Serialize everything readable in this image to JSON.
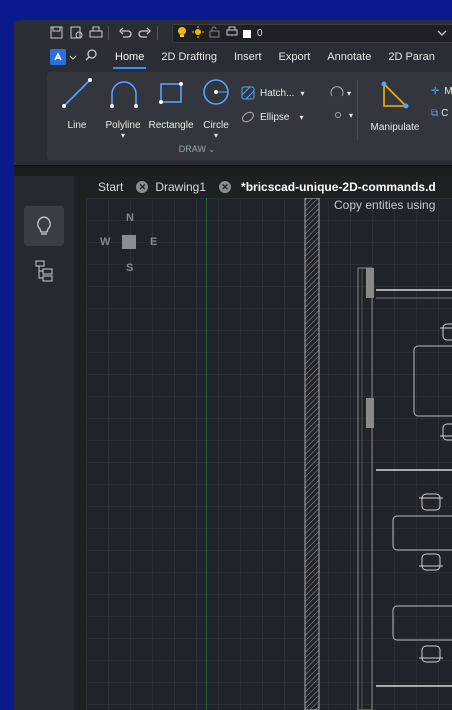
{
  "qat": {
    "layer_value": "0"
  },
  "ribbon": {
    "tabs": [
      "Home",
      "2D Drafting",
      "Insert",
      "Export",
      "Annotate",
      "2D Paran"
    ],
    "active_tab": "Home",
    "tools": {
      "line": "Line",
      "polyline": "Polyline",
      "rectangle": "Rectangle",
      "circle": "Circle",
      "manipulate": "Manipulate"
    },
    "small": {
      "hatch": "Hatch...",
      "ellipse": "Ellipse",
      "move_abbr": "M",
      "copy_abbr": "C"
    },
    "panel_title": "DRAW"
  },
  "doc_tabs": [
    "Start",
    "Drawing1",
    "*bricscad-unique-2D-commands.d"
  ],
  "compass": {
    "n": "N",
    "s": "S",
    "e": "E",
    "w": "W"
  },
  "canvas": {
    "hint": "Copy entities using"
  }
}
